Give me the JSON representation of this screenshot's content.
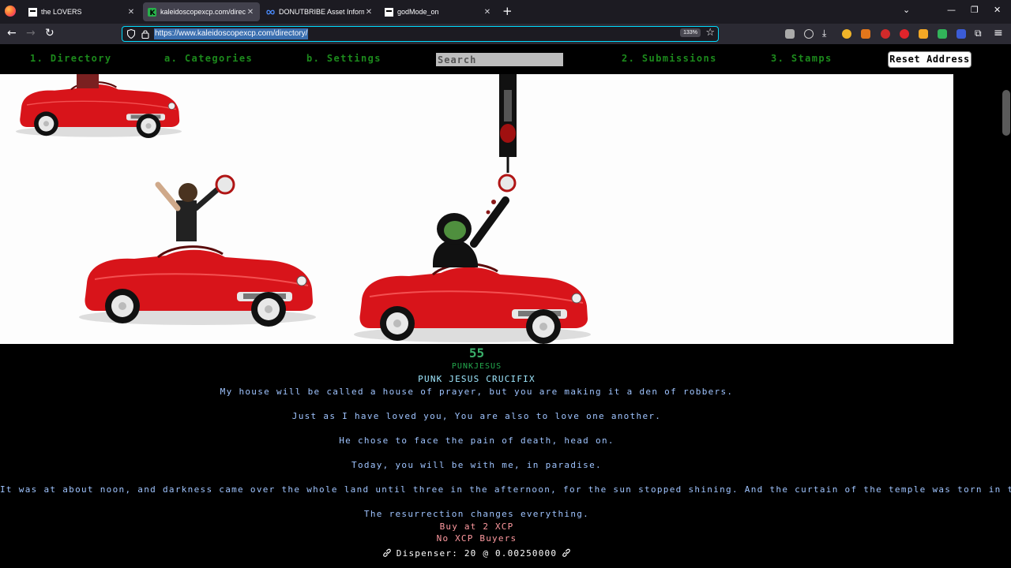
{
  "browser": {
    "tabs": [
      {
        "label": "the LOVERS"
      },
      {
        "label": "kaleidoscopexcp.com/directory/"
      },
      {
        "label": "DONUTBRIBE Asset Information"
      },
      {
        "label": "godMode_on"
      }
    ],
    "url": "https://www.kaleidoscopexcp.com/directory/",
    "zoom": "133%"
  },
  "nav": {
    "directory": "1. Directory",
    "categories": "a. Categories",
    "settings": "b. Settings",
    "search_placeholder": "Search",
    "submissions": "2. Submissions",
    "stamps": "3. Stamps",
    "reset": "Reset Address"
  },
  "asset": {
    "number": "55",
    "ticker": "PUNKJESUS",
    "title": "PUNK JESUS CRUCIFIX",
    "description": [
      "My house will be called a house of prayer, but you are making it a den of robbers.",
      "Just as I have loved you, You are also to love one another.",
      "He chose to face the pain of death, head on.",
      "Today, you will be with me, in paradise.",
      "It was at about noon, and darkness came over the whole land until three in the afternoon, for the sun stopped shining. And the curtain of the temple was torn in two",
      "The resurrection changes everything."
    ],
    "buy": "Buy at 2 XCP",
    "no_buyers": "No XCP Buyers",
    "dispenser": "Dispenser: 20 @ 0.00250000"
  },
  "colors": {
    "nav_green": "#1c8a1c",
    "accent_blue": "#00ddff",
    "car_red": "#d8141a"
  }
}
